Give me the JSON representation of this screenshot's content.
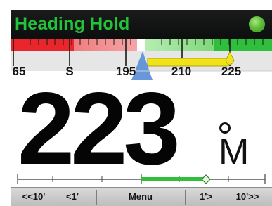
{
  "title_bar": {
    "mode_title": "Heading Hold",
    "status_led_color": "#5fbd3c"
  },
  "heading_tape": {
    "labels": [
      "65",
      "S",
      "195",
      "210",
      "225"
    ],
    "course_marker_color": "#5b8fd6",
    "target_marker_color": "#f2e21a"
  },
  "heading_display": {
    "value": "223",
    "unit": "M",
    "degree_symbol": true
  },
  "rudder_bar": {
    "indicator_color": "#2fbf3c"
  },
  "softkeys": {
    "left_large": "<<10'",
    "left_small": "<1'",
    "menu": "Menu",
    "right_small": "1'>",
    "right_large": "10'>>"
  },
  "colors": {
    "title_text": "#22c23a",
    "port_band": "#e8262c",
    "starboard_band": "#2fbf3c"
  }
}
